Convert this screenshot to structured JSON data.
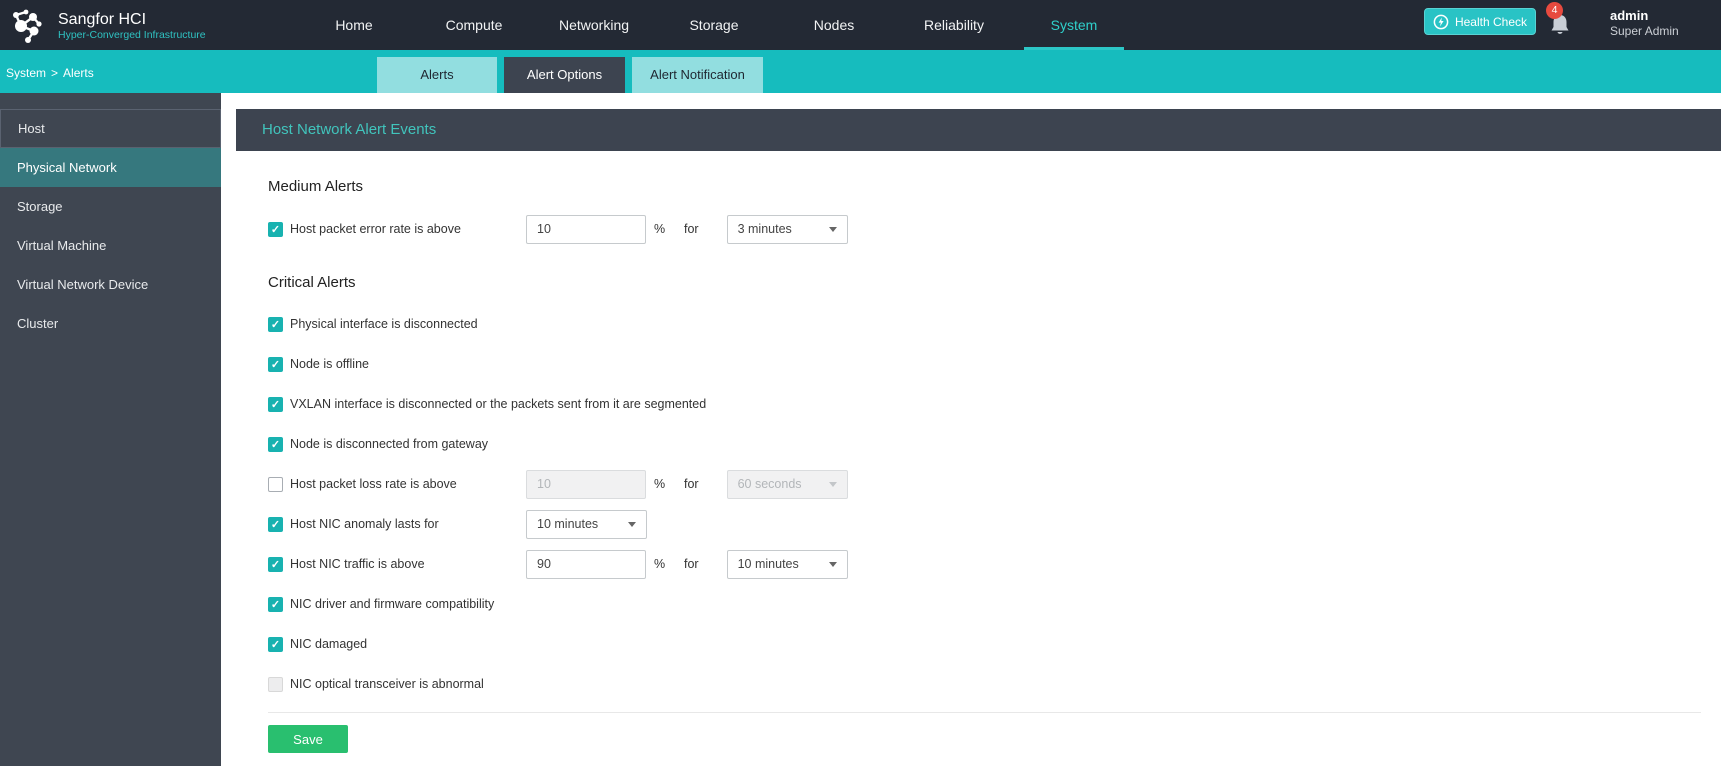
{
  "brand": {
    "title": "Sangfor HCI",
    "subtitle": "Hyper-Converged Infrastructure"
  },
  "nav": {
    "items": [
      {
        "label": "Home"
      },
      {
        "label": "Compute"
      },
      {
        "label": "Networking"
      },
      {
        "label": "Storage"
      },
      {
        "label": "Nodes"
      },
      {
        "label": "Reliability"
      },
      {
        "label": "System",
        "active": true
      }
    ]
  },
  "topbar_right": {
    "health_check_label": "Health Check",
    "notification_count": "4",
    "username": "admin",
    "role": "Super Admin"
  },
  "breadcrumb": {
    "section": "System",
    "separator": ">",
    "page": "Alerts"
  },
  "tabs": [
    {
      "label": "Alerts"
    },
    {
      "label": "Alert Options",
      "active": true
    },
    {
      "label": "Alert Notification"
    }
  ],
  "sidebar": {
    "items": [
      {
        "label": "Host"
      },
      {
        "label": "Physical Network",
        "active": true
      },
      {
        "label": "Storage"
      },
      {
        "label": "Virtual Machine"
      },
      {
        "label": "Virtual Network Device"
      },
      {
        "label": "Cluster"
      }
    ]
  },
  "content": {
    "title": "Host Network Alert Events",
    "medium": {
      "heading": "Medium Alerts",
      "rows": [
        {
          "label": "Host packet error rate is above",
          "checked": true,
          "value": "10",
          "unit": "%",
          "for_label": "for",
          "duration": "3 minutes"
        }
      ]
    },
    "critical": {
      "heading": "Critical Alerts",
      "rows": [
        {
          "label": "Physical interface is disconnected",
          "checked": true
        },
        {
          "label": "Node is offline",
          "checked": true
        },
        {
          "label": "VXLAN interface is disconnected or the packets sent from it are segmented",
          "checked": true
        },
        {
          "label": "Node is disconnected from gateway",
          "checked": true
        },
        {
          "label": "Host packet loss rate is above",
          "checked": false,
          "controls_disabled": true,
          "value": "10",
          "unit": "%",
          "for_label": "for",
          "duration": "60 seconds"
        },
        {
          "label": "Host NIC anomaly lasts for",
          "checked": true,
          "duration": "10 minutes"
        },
        {
          "label": "Host NIC traffic is above",
          "checked": true,
          "value": "90",
          "unit": "%",
          "for_label": "for",
          "duration": "10 minutes"
        },
        {
          "label": "NIC driver and firmware compatibility",
          "checked": true
        },
        {
          "label": "NIC damaged",
          "checked": true
        },
        {
          "label": "NIC optical transceiver is abnormal",
          "checked": false,
          "checkbox_disabled": true
        }
      ]
    },
    "save_label": "Save"
  },
  "colors": {
    "teal_bar": "#16bcbe",
    "nav_dark": "#232934",
    "panel_dark": "#3d4450",
    "sidebar_dark": "#3f4651",
    "sidebar_active_teal": "#36787e",
    "checkbox_teal": "#18b2b0",
    "title_teal": "#41c4bc",
    "save_green": "#29bf6f",
    "badge_red": "#e74a3f"
  }
}
